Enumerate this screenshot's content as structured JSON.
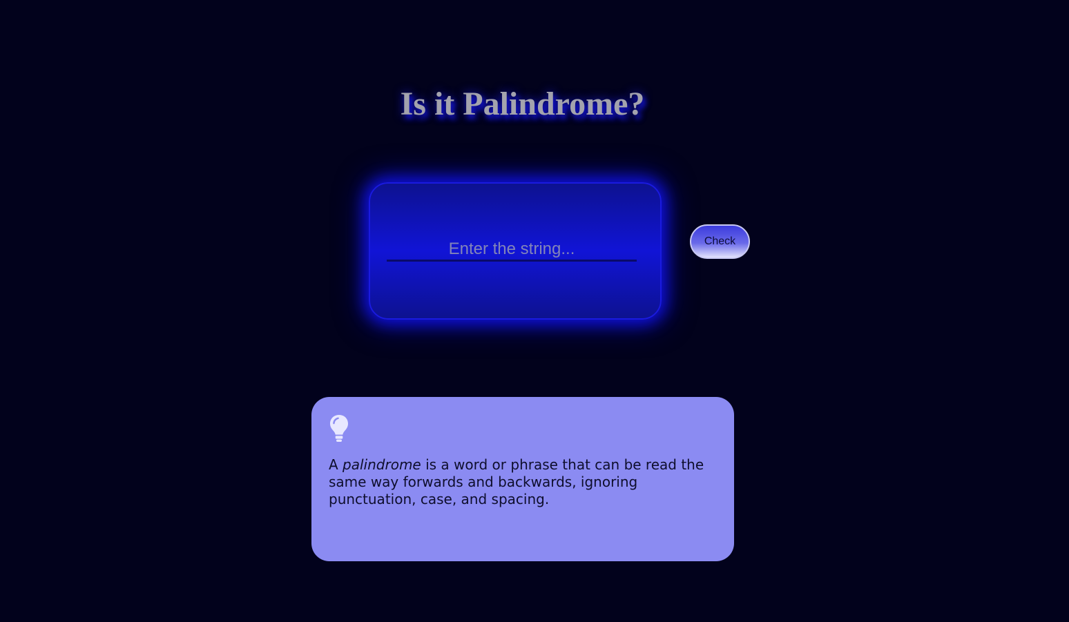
{
  "header": {
    "title": "Is it Palindrome?"
  },
  "form": {
    "input_placeholder": "Enter the string...",
    "input_value": "",
    "check_label": "Check"
  },
  "info": {
    "icon": "lightbulb-icon",
    "text_before": "A ",
    "text_emphasis": "palindrome",
    "text_after": " is a word or phrase that can be read the same way forwards and backwards, ignoring punctuation, case, and spacing."
  },
  "colors": {
    "background": "#02021c",
    "input_card": "#1114d6",
    "glow": "#0f10d8",
    "button": "#5a5ae6",
    "info_card": "#8b8bf2",
    "icon": "#e8e8ff"
  }
}
